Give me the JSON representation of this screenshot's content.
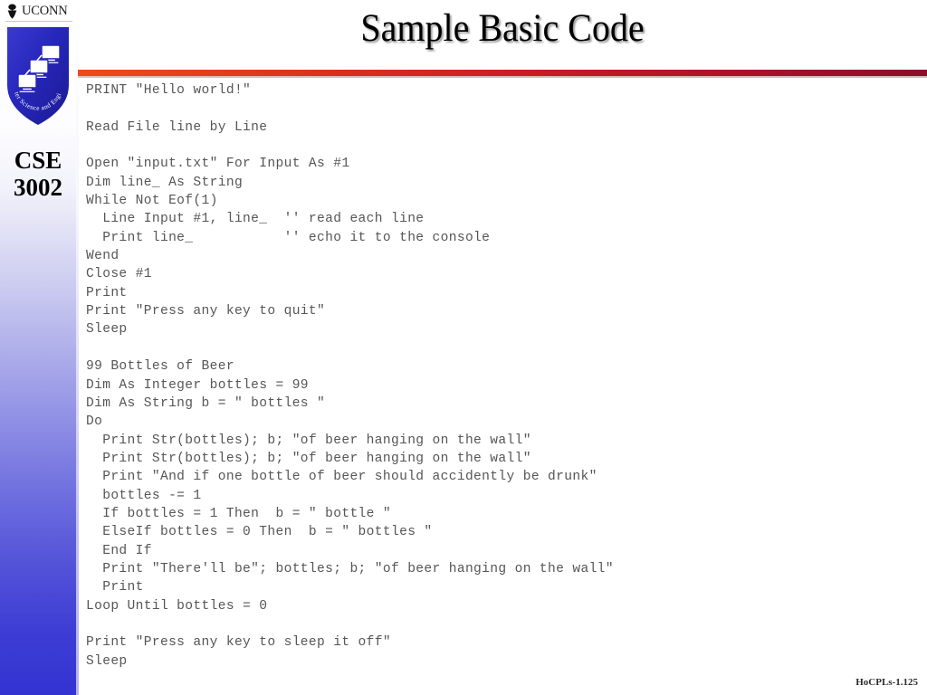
{
  "slide": {
    "title": "Sample Basic Code",
    "footer": "HoCPLs-1.125",
    "background_color": "#ffffff"
  },
  "branding": {
    "university_wordmark": "UCONN",
    "crest_icon": "uconn-crest-icon",
    "shield_icon": "cse-shield-icon",
    "shield_caption": "Computer Science and Engineering",
    "shield_color": "#2a2ab8",
    "course_code": "CSE",
    "course_number": "3002",
    "sidebar_gradient_top": "#ffffff",
    "sidebar_gradient_bottom": "#3333d2"
  },
  "rule": {
    "color_left": "#ef4a17",
    "color_right": "#8b0e2a"
  },
  "code": {
    "language": "BASIC",
    "text_color": "#565656",
    "lines": [
      "PRINT \"Hello world!\"",
      "",
      "Read File line by Line",
      "",
      "Open \"input.txt\" For Input As #1",
      "Dim line_ As String",
      "While Not Eof(1)",
      "  Line Input #1, line_  '' read each line",
      "  Print line_           '' echo it to the console",
      "Wend",
      "Close #1",
      "Print",
      "Print \"Press any key to quit\"",
      "Sleep",
      "",
      "99 Bottles of Beer",
      "Dim As Integer bottles = 99",
      "Dim As String b = \" bottles \"",
      "Do",
      "  Print Str(bottles); b; \"of beer hanging on the wall\"",
      "  Print Str(bottles); b; \"of beer hanging on the wall\"",
      "  Print \"And if one bottle of beer should accidently be drunk\"",
      "  bottles -= 1",
      "  If bottles = 1 Then  b = \" bottle \"",
      "  ElseIf bottles = 0 Then  b = \" bottles \"",
      "  End If",
      "  Print \"There'll be\"; bottles; b; \"of beer hanging on the wall\"",
      "  Print",
      "Loop Until bottles = 0",
      "",
      "Print \"Press any key to sleep it off\"",
      "Sleep"
    ]
  }
}
